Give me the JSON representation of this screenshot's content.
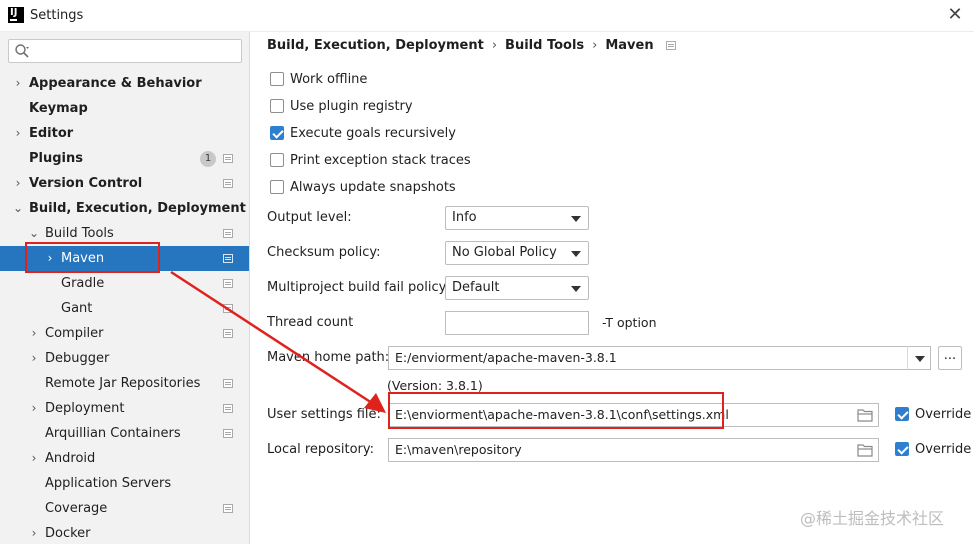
{
  "window": {
    "title": "Settings",
    "close": "✕"
  },
  "search": {
    "placeholder": "",
    "value": ""
  },
  "sidebar": {
    "items": [
      {
        "label": "Appearance & Behavior",
        "expand": "›",
        "badge": ""
      },
      {
        "label": "Keymap",
        "expand": "",
        "badge": ""
      },
      {
        "label": "Editor",
        "expand": "›",
        "badge": ""
      },
      {
        "label": "Plugins",
        "expand": "",
        "badge": "1"
      },
      {
        "label": "Version Control",
        "expand": "›",
        "badge": ""
      },
      {
        "label": "Build, Execution, Deployment",
        "expand": "⌄",
        "badge": ""
      },
      {
        "label": "Build Tools",
        "expand": "⌄",
        "badge": ""
      },
      {
        "label": "Maven",
        "expand": "›",
        "badge": ""
      },
      {
        "label": "Gradle",
        "expand": "",
        "badge": ""
      },
      {
        "label": "Gant",
        "expand": "",
        "badge": ""
      },
      {
        "label": "Compiler",
        "expand": "›",
        "badge": ""
      },
      {
        "label": "Debugger",
        "expand": "›",
        "badge": ""
      },
      {
        "label": "Remote Jar Repositories",
        "expand": "",
        "badge": ""
      },
      {
        "label": "Deployment",
        "expand": "›",
        "badge": ""
      },
      {
        "label": "Arquillian Containers",
        "expand": "",
        "badge": ""
      },
      {
        "label": "Android",
        "expand": "›",
        "badge": ""
      },
      {
        "label": "Application Servers",
        "expand": "",
        "badge": ""
      },
      {
        "label": "Coverage",
        "expand": "",
        "badge": ""
      },
      {
        "label": "Docker",
        "expand": "›",
        "badge": ""
      }
    ]
  },
  "breadcrumb": {
    "parts": [
      "Build, Execution, Deployment",
      "Build Tools",
      "Maven"
    ],
    "separator": "›"
  },
  "options": [
    {
      "label": "Work offline",
      "checked": false
    },
    {
      "label": "Use plugin registry",
      "checked": false
    },
    {
      "label": "Execute goals recursively",
      "checked": true
    },
    {
      "label": "Print exception stack traces",
      "checked": false
    },
    {
      "label": "Always update snapshots",
      "checked": false
    }
  ],
  "form": {
    "output_level": {
      "label": "Output level:",
      "value": "Info"
    },
    "checksum_policy": {
      "label": "Checksum policy:",
      "value": "No Global Policy"
    },
    "multiproject_fail": {
      "label": "Multiproject build fail policy:",
      "value": "Default"
    },
    "thread_count": {
      "label": "Thread count",
      "value": "",
      "suffix": "-T option"
    },
    "maven_home": {
      "label": "Maven home path:",
      "value": "E:/enviorment/apache-maven-3.8.1",
      "browse": "...",
      "version": "(Version: 3.8.1)"
    },
    "user_settings": {
      "label": "User settings file:",
      "value": "E:\\enviorment\\apache-maven-3.8.1\\conf\\settings.xml",
      "override": "Override",
      "override_checked": true
    },
    "local_repo": {
      "label": "Local repository:",
      "value": "E:\\maven\\repository",
      "override": "Override",
      "override_checked": true
    }
  },
  "watermark": "@稀土掘金技术社区",
  "colors": {
    "selection": "#2675bf",
    "checkbox": "#2f7fd1",
    "annotation": "#e0221d"
  }
}
